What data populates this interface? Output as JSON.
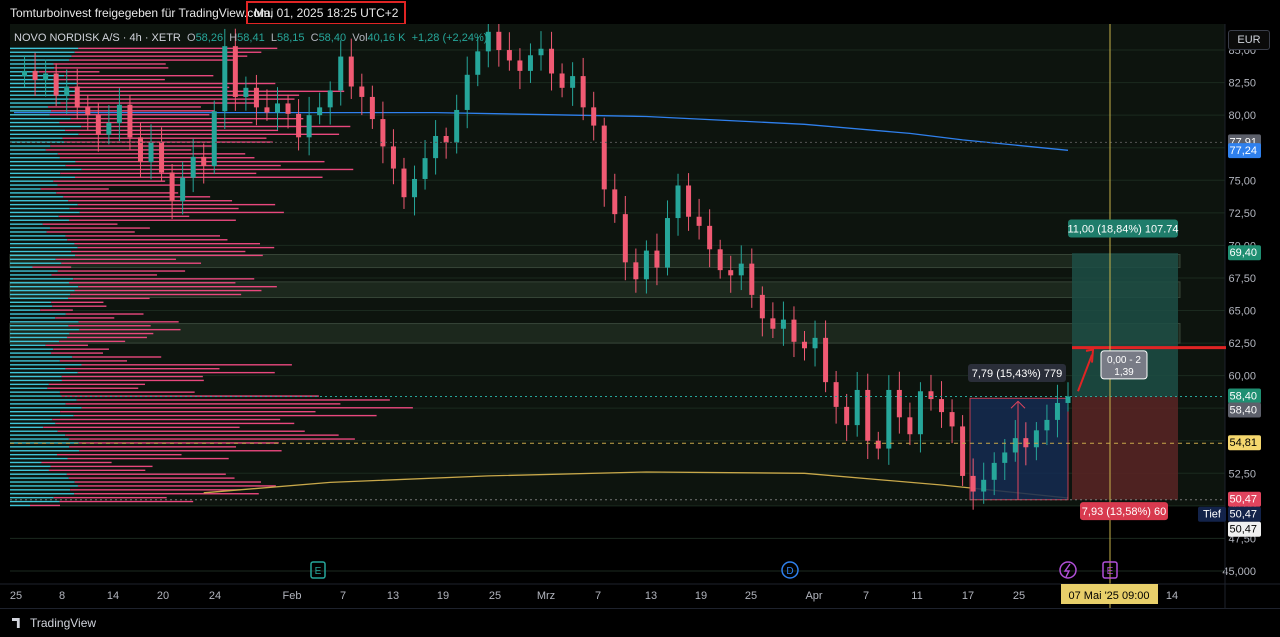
{
  "header": {
    "shared_by": "Tomturboinvest freigegeben für TradingView.com,",
    "timestamp": "Mai 01, 2025 18:25 UTC+2"
  },
  "legend": {
    "symbol": "NOVO NORDISK A/S · 4h · XETR",
    "open_label": "O",
    "open": "58,26",
    "high_label": "H",
    "high": "58,41",
    "low_label": "L",
    "low": "58,15",
    "close_label": "C",
    "close": "58,40",
    "vol_label": "Vol",
    "vol": "40,16 K",
    "change": "+1,28 (+2,24%)"
  },
  "currency": "EUR",
  "footer": {
    "brand": "TradingView"
  },
  "colors": {
    "up": "#26a69a",
    "down": "#ef5350",
    "candle_down": "#f05a73",
    "vp_up": "#3fc4d6",
    "vp_down": "#e8487d",
    "ma_blue": "#2f80ed",
    "ma_yellow": "#c8a84a",
    "target_fill": "#1d4d45",
    "stop_fill": "#5a2424"
  },
  "chart_data": {
    "type": "candlestick",
    "timeframe": "4h",
    "ylim": [
      44,
      87
    ],
    "y_ticks": [
      "45,000",
      "47,50",
      "50,00",
      "52,50",
      "55,00",
      "57,50",
      "60,00",
      "62,50",
      "65,00",
      "67,50",
      "70,00",
      "72,50",
      "75,00",
      "77,50",
      "80,00",
      "82,50",
      "85,00"
    ],
    "x_ticks": [
      "25",
      "8",
      "14",
      "20",
      "24",
      "Feb",
      "7",
      "13",
      "19",
      "25",
      "Mrz",
      "7",
      "13",
      "19",
      "25",
      "Apr",
      "7",
      "11",
      "17",
      "25",
      "14"
    ],
    "cursor_date_label": "07 Mai '25   09:00",
    "tiefs_label": "Tief",
    "price_badges": [
      {
        "value": "77,91",
        "style": "gray"
      },
      {
        "value": "77,24",
        "style": "blue"
      },
      {
        "value": "69,40",
        "style": "green"
      },
      {
        "value": "58,40",
        "style": "green"
      },
      {
        "value": "58,40",
        "style": "gray"
      },
      {
        "value": "54,81",
        "style": "yellow"
      },
      {
        "value": "50,47",
        "style": "red"
      },
      {
        "value": "50,47",
        "style": "navy"
      },
      {
        "value": "50,47",
        "style": "white"
      }
    ],
    "close_path": [
      [
        0,
        83.0
      ],
      [
        1,
        83.4
      ],
      [
        2,
        82.7
      ],
      [
        3,
        83.2
      ],
      [
        4,
        81.5
      ],
      [
        5,
        82.2
      ],
      [
        6,
        80.6
      ],
      [
        7,
        80.0
      ],
      [
        8,
        78.5
      ],
      [
        9,
        79.4
      ],
      [
        10,
        80.8
      ],
      [
        11,
        78.3
      ],
      [
        12,
        76.4
      ],
      [
        13,
        77.9
      ],
      [
        14,
        75.6
      ],
      [
        15,
        73.4
      ],
      [
        16,
        75.2
      ],
      [
        17,
        76.8
      ],
      [
        18,
        76.1
      ],
      [
        19,
        80.3
      ],
      [
        20,
        85.3
      ],
      [
        21,
        81.4
      ],
      [
        22,
        82.1
      ],
      [
        23,
        80.6
      ],
      [
        24,
        80.2
      ],
      [
        25,
        80.9
      ],
      [
        26,
        80.1
      ],
      [
        27,
        78.3
      ],
      [
        28,
        80.0
      ],
      [
        29,
        80.6
      ],
      [
        30,
        81.9
      ],
      [
        31,
        84.5
      ],
      [
        32,
        82.2
      ],
      [
        33,
        81.4
      ],
      [
        34,
        79.7
      ],
      [
        35,
        77.6
      ],
      [
        36,
        75.9
      ],
      [
        37,
        73.7
      ],
      [
        38,
        75.1
      ],
      [
        39,
        76.7
      ],
      [
        40,
        78.4
      ],
      [
        41,
        77.9
      ],
      [
        42,
        80.4
      ],
      [
        43,
        83.1
      ],
      [
        44,
        84.9
      ],
      [
        45,
        86.4
      ],
      [
        46,
        85.0
      ],
      [
        47,
        84.2
      ],
      [
        48,
        83.4
      ],
      [
        49,
        84.6
      ],
      [
        50,
        85.1
      ],
      [
        51,
        83.2
      ],
      [
        52,
        82.1
      ],
      [
        53,
        83.0
      ],
      [
        54,
        80.6
      ],
      [
        55,
        79.2
      ],
      [
        56,
        74.3
      ],
      [
        57,
        72.4
      ],
      [
        58,
        68.7
      ],
      [
        59,
        67.4
      ],
      [
        60,
        69.6
      ],
      [
        61,
        68.3
      ],
      [
        62,
        72.1
      ],
      [
        63,
        74.6
      ],
      [
        64,
        72.2
      ],
      [
        65,
        71.5
      ],
      [
        66,
        69.7
      ],
      [
        67,
        68.1
      ],
      [
        68,
        67.7
      ],
      [
        69,
        68.6
      ],
      [
        70,
        66.2
      ],
      [
        71,
        64.4
      ],
      [
        72,
        63.6
      ],
      [
        73,
        64.3
      ],
      [
        74,
        62.6
      ],
      [
        75,
        62.1
      ],
      [
        76,
        62.9
      ],
      [
        77,
        59.5
      ],
      [
        78,
        57.6
      ],
      [
        79,
        56.2
      ],
      [
        80,
        58.9
      ],
      [
        81,
        55.0
      ],
      [
        82,
        54.4
      ],
      [
        83,
        58.9
      ],
      [
        84,
        56.8
      ],
      [
        85,
        55.5
      ],
      [
        86,
        58.8
      ],
      [
        87,
        58.2
      ],
      [
        88,
        57.2
      ],
      [
        89,
        56.1
      ],
      [
        90,
        52.3
      ],
      [
        91,
        51.1
      ],
      [
        92,
        52.0
      ],
      [
        93,
        53.3
      ],
      [
        94,
        54.1
      ],
      [
        95,
        55.2
      ],
      [
        96,
        54.5
      ],
      [
        97,
        55.8
      ],
      [
        98,
        56.6
      ],
      [
        99,
        57.9
      ],
      [
        100,
        58.4
      ]
    ],
    "moving_averages": [
      {
        "color": "#2f80ed",
        "points": [
          [
            0,
            80.2
          ],
          [
            40,
            80.2
          ],
          [
            60,
            79.9
          ],
          [
            75,
            79.3
          ],
          [
            85,
            78.6
          ],
          [
            90,
            78.1
          ],
          [
            100,
            77.3
          ]
        ]
      },
      {
        "color": "#c8a84a",
        "points": [
          [
            18,
            51.0
          ],
          [
            30,
            51.8
          ],
          [
            45,
            52.3
          ],
          [
            60,
            52.6
          ],
          [
            75,
            52.5
          ],
          [
            88,
            51.6
          ],
          [
            100,
            50.6
          ]
        ]
      }
    ],
    "annotations": {
      "range_measure": {
        "label": "7,79 (15,43%) 779",
        "from": 50.47,
        "to": 58.26
      },
      "long_target": {
        "label": "11,00 (18,84%) 107.74",
        "entry": 58.4,
        "target": 69.4
      },
      "long_stop": {
        "label": "7,93 (13,58%) 60",
        "stop": 50.47
      },
      "measure_small": {
        "line1": "0,00 - 2",
        "line2": "1,39"
      },
      "horizontal_red": 62.15,
      "zones": [
        [
          69.3,
          68.3
        ],
        [
          67.2,
          66.0
        ],
        [
          64.0,
          62.5
        ]
      ]
    },
    "volume_profile": {
      "sides": [
        "up",
        "down"
      ]
    },
    "event_markers": [
      "E",
      "D",
      "E"
    ]
  }
}
